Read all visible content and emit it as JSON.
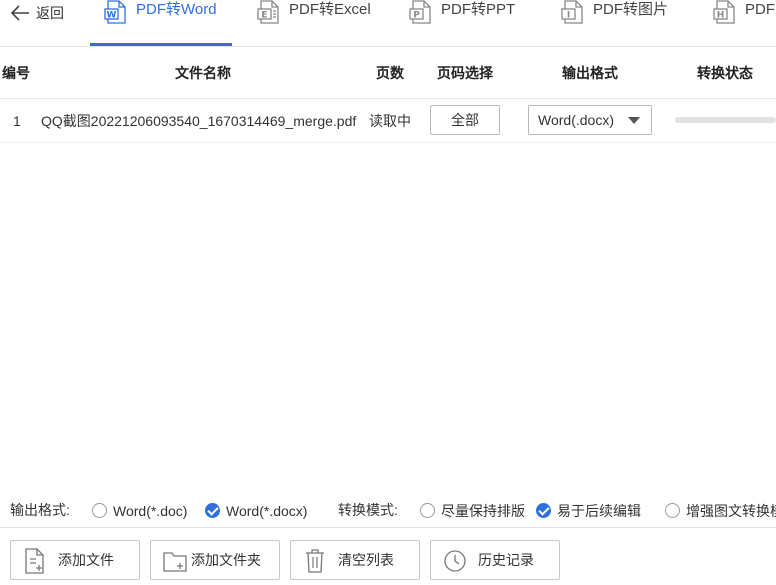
{
  "header": {
    "back_label": "返回",
    "tabs": [
      {
        "label": "PDF转Word",
        "icon": "pdf-w-icon",
        "letter": "W",
        "active": true
      },
      {
        "label": "PDF转Excel",
        "icon": "pdf-excel-icon",
        "letter": "E",
        "active": false
      },
      {
        "label": "PDF转PPT",
        "icon": "pdf-ppt-icon",
        "letter": "P",
        "active": false
      },
      {
        "label": "PDF转图片",
        "icon": "pdf-image-icon",
        "letter": "I",
        "active": false
      },
      {
        "label": "PDF",
        "icon": "pdf-html-icon",
        "letter": "H",
        "active": false
      }
    ]
  },
  "table": {
    "columns": [
      "编号",
      "文件名称",
      "页数",
      "页码选择",
      "输出格式",
      "转换状态"
    ],
    "rows": [
      {
        "index": "1",
        "filename": "QQ截图20221206093540_1670314469_merge.pdf",
        "pages": "读取中",
        "page_select_label": "全部",
        "output_format": "Word(.docx)",
        "progress": 0
      }
    ]
  },
  "options": {
    "output_format_label": "输出格式:",
    "output_formats": [
      {
        "label": "Word(*.doc)",
        "checked": false
      },
      {
        "label": "Word(*.docx)",
        "checked": true
      }
    ],
    "mode_label": "转换模式:",
    "modes": [
      {
        "label": "尽量保持排版",
        "checked": false
      },
      {
        "label": "易于后续编辑",
        "checked": true
      },
      {
        "label": "增强图文转换模式",
        "checked": false
      }
    ]
  },
  "buttons": {
    "add_file": "添加文件",
    "add_folder": "添加文件夹",
    "clear_list": "清空列表",
    "history": "历史记录"
  },
  "colors": {
    "accent": "#2f6fde"
  }
}
